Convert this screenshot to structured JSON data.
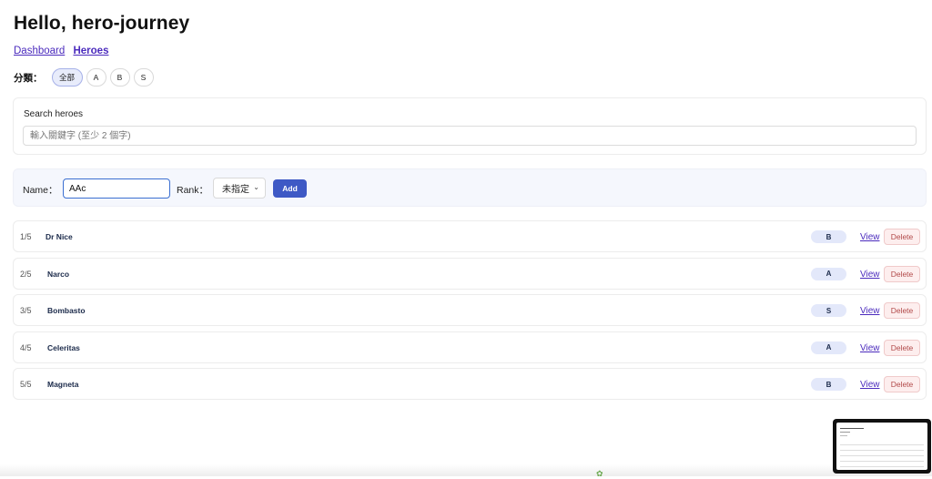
{
  "header": {
    "title": "Hello, hero-journey"
  },
  "nav": [
    {
      "label": "Dashboard",
      "active": false
    },
    {
      "label": "Heroes",
      "active": true
    }
  ],
  "filter": {
    "label": "分類：",
    "options": [
      "全部",
      "A",
      "B",
      "S"
    ],
    "selected": "全部"
  },
  "search": {
    "label": "Search heroes",
    "placeholder": "輸入關鍵字 (至少 2 個字)",
    "value": ""
  },
  "add_form": {
    "name_label": "Name：",
    "name_value": "AAc",
    "rank_label": "Rank：",
    "rank_value": "未指定",
    "add_label": "Add"
  },
  "heroes": [
    {
      "index": "1/5",
      "name": "Dr Nice",
      "rank": "B",
      "view": "View",
      "delete": "Delete"
    },
    {
      "index": "2/5",
      "name": "Narco",
      "rank": "A",
      "view": "View",
      "delete": "Delete"
    },
    {
      "index": "3/5",
      "name": "Bombasto",
      "rank": "S",
      "view": "View",
      "delete": "Delete"
    },
    {
      "index": "4/5",
      "name": "Celeritas",
      "rank": "A",
      "view": "View",
      "delete": "Delete"
    },
    {
      "index": "5/5",
      "name": "Magneta",
      "rank": "B",
      "view": "View",
      "delete": "Delete"
    }
  ],
  "colors": {
    "accent": "#3e59c5",
    "link": "#4b2bbd",
    "delete_bg": "#fdeeee",
    "badge_bg": "#e3e8fa"
  }
}
